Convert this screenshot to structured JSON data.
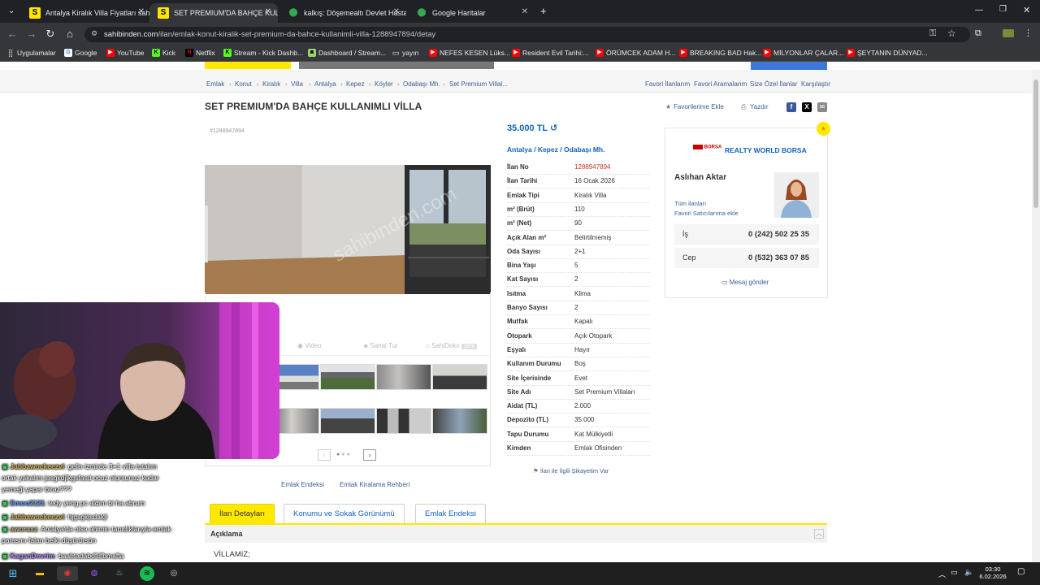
{
  "browser": {
    "tabs": [
      {
        "label": "Antalya Kiralık Villa Fiyatları sah",
        "icon": "sahibinden-favicon",
        "active": false
      },
      {
        "label": "SET PREMIUM'DA BAHÇE KULL",
        "icon": "sahibinden-favicon",
        "active": true
      },
      {
        "label": "kalkış: Döşemealtı Devlet Hasta",
        "icon": "maps-pin-icon",
        "active": false
      },
      {
        "label": "Google Haritalar",
        "icon": "maps-pin-icon",
        "active": false
      }
    ],
    "url_host": "sahibinden.com",
    "url_path": "/ilan/emlak-konut-kiralik-set-premium-da-bahce-kullanimli-villa-1288947894/detay",
    "bookmarks": [
      "Uygulamalar",
      "Google",
      "YouTube",
      "Kick",
      "Netflix",
      "Stream - Kick Dashb...",
      "Dashboard / Stream...",
      "yayın",
      "NEFES KESEN Lüks...",
      "Resident Evil Tarihi:...",
      "ÖRÜMCEK ADAM H...",
      "BREAKING BAD Hak...",
      "MİLYONLAR ÇALAR...",
      "ŞEYTANIN DÜNYAD..."
    ]
  },
  "breadcrumb": [
    "Emlak",
    "Konut",
    "Kiralık",
    "Villa",
    "Antalya",
    "Kepez",
    "Köyler",
    "Odabaşı Mh.",
    "Set Premium Villal..."
  ],
  "top_links": [
    "Favori İlanlarım",
    "Favori Aramalarım",
    "Size Özel İlanlar",
    "Karşılaştır"
  ],
  "listing": {
    "title": "SET PREMIUM'DA BAHÇE KULLANIMLI VİLLA",
    "favorite_label": "Favorilerime Ekle",
    "print_label": "Yazdır",
    "number_tag": "#1288947894",
    "price": "35.000 TL",
    "location": [
      "Antalya",
      "Kepez",
      "Odabaşı Mh."
    ],
    "watermark": "sahibinden.com",
    "details": [
      {
        "k": "İlan No",
        "v": "1288947894",
        "red": true
      },
      {
        "k": "İlan Tarihi",
        "v": "16 Ocak 2026"
      },
      {
        "k": "Emlak Tipi",
        "v": "Kiralık Villa"
      },
      {
        "k": "m² (Brüt)",
        "v": "110"
      },
      {
        "k": "m² (Net)",
        "v": "90"
      },
      {
        "k": "Açık Alan m²",
        "v": "Belirtilmemiş"
      },
      {
        "k": "Oda Sayısı",
        "v": "2+1"
      },
      {
        "k": "Bina Yaşı",
        "v": "5"
      },
      {
        "k": "Kat Sayısı",
        "v": "2"
      },
      {
        "k": "Isıtma",
        "v": "Klima"
      },
      {
        "k": "Banyo Sayısı",
        "v": "2"
      },
      {
        "k": "Mutfak",
        "v": "Kapalı"
      },
      {
        "k": "Otopark",
        "v": "Açık Otopark"
      },
      {
        "k": "Eşyalı",
        "v": "Hayır"
      },
      {
        "k": "Kullanım Durumu",
        "v": "Boş"
      },
      {
        "k": "Site İçerisinde",
        "v": "Evet"
      },
      {
        "k": "Site Adı",
        "v": "Set Premium Villaları"
      },
      {
        "k": "Aidat (TL)",
        "v": "2.000"
      },
      {
        "k": "Depozito (TL)",
        "v": "35.000"
      },
      {
        "k": "Tapu Durumu",
        "v": "Kat Mülkiyetli"
      },
      {
        "k": "Kimden",
        "v": "Emlak Ofisinden"
      }
    ],
    "complaint": "İlan ile İlgili Şikayetim Var",
    "gallery_tabs": [
      "Video",
      "Sanal Tur",
      "SahiDeko"
    ],
    "sahideko_badge": "yeni",
    "extra_links": [
      "Emlak Endeksi",
      "Emlak Kiralama Rehberi"
    ]
  },
  "seller": {
    "agency": "REALTY WORLD BORSA",
    "agency_logo": "BORSA",
    "name": "Aslıhan Aktar",
    "all_listings": "Tüm ilanları",
    "add_favorite": "Favori Satıcılarıma ekle",
    "phones": [
      {
        "label": "İş",
        "number": "0 (242) 502 25 35"
      },
      {
        "label": "Cep",
        "number": "0 (532) 363 07 85"
      }
    ],
    "message": "Mesaj gönder"
  },
  "section_tabs": [
    "İlan Detayları",
    "Konumu ve Sokak Görünümü",
    "Emlak Endeksi"
  ],
  "description_header": "Açıklama",
  "description_start": "VİLLAMIZ;",
  "chat": [
    {
      "user": "Jabbawockeezvl",
      "msg": ": gelin izmirde 3+1 villa tutalım ortak yakalım jasgkdjlkgsfasd ocuz olursunuz kadar yemeği yapar biraz???",
      "color": "#d4b64a"
    },
    {
      "user": "Emoo2121",
      "msg": ": tedy yeng pc aldım bi ha abrum",
      "color": "#6aa5ff"
    },
    {
      "user": "Jabbawockeezvl",
      "msg": ": hjgsgkjsdakjl",
      "color": "#d4b64a"
    },
    {
      "user": "aworaxz",
      "msg": ": Antalya'da olsa ahimin tanıdıklarıyla emlak parasını falan belki düşürürsün",
      "color": "#c9b38a"
    },
    {
      "user": "KaganDevrim",
      "msg": ": baabtadabdfdfbmafta",
      "color": "#b78cff"
    }
  ],
  "taskbar": {
    "time": "03:30",
    "date": "6.02.2026"
  }
}
